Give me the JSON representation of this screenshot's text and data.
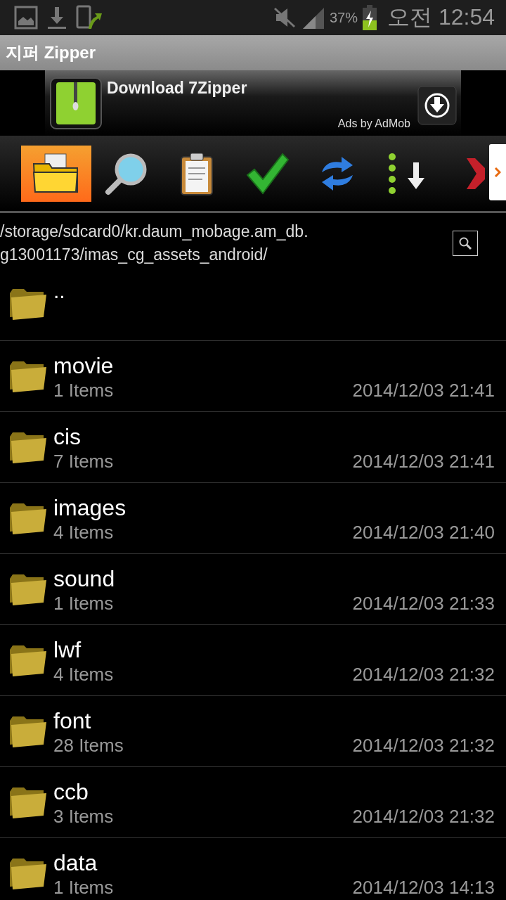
{
  "status_bar": {
    "battery_percent": "37%",
    "time": "오전 12:54"
  },
  "app_title": "지퍼 Zipper",
  "ad": {
    "title": "Download 7Zipper",
    "credit": "Ads by AdMob"
  },
  "toolbar": [
    {
      "kind": "folder",
      "selected": true
    },
    {
      "kind": "search",
      "selected": false
    },
    {
      "kind": "clipboard",
      "selected": false
    },
    {
      "kind": "check",
      "selected": false
    },
    {
      "kind": "refresh",
      "selected": false
    },
    {
      "kind": "sort",
      "selected": false
    },
    {
      "kind": "delete",
      "selected": false
    }
  ],
  "path": "/storage/sdcard0/kr.daum_mobage.am_db.\ng13001173/imas_cg_assets_android/",
  "parent": {
    "name": ".."
  },
  "folders": [
    {
      "name": "movie",
      "count": "1 Items",
      "date": "2014/12/03 21:41"
    },
    {
      "name": "cis",
      "count": "7 Items",
      "date": "2014/12/03 21:41"
    },
    {
      "name": "images",
      "count": "4 Items",
      "date": "2014/12/03 21:40"
    },
    {
      "name": "sound",
      "count": "1 Items",
      "date": "2014/12/03 21:33"
    },
    {
      "name": "lwf",
      "count": "4 Items",
      "date": "2014/12/03 21:32"
    },
    {
      "name": "font",
      "count": "28 Items",
      "date": "2014/12/03 21:32"
    },
    {
      "name": "ccb",
      "count": "3 Items",
      "date": "2014/12/03 21:32"
    },
    {
      "name": "data",
      "count": "1 Items",
      "date": "2014/12/03 14:13"
    }
  ]
}
